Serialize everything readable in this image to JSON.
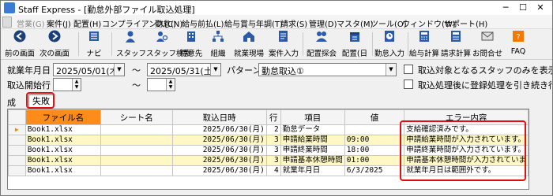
{
  "window": {
    "title": "Staff Express - [勤怠外部ファイル取込処理]"
  },
  "menu": [
    "営業(G)",
    "案件(J)",
    "配置(H)",
    "コンプライアンス(C)",
    "勤怠(N)",
    "給与前払(L)",
    "給与賞与年調(T)",
    "請求(S)",
    "管理(D)",
    "マスタ(M)",
    "ツール(O)",
    "ウィンドウ(W)",
    "サポート(H)"
  ],
  "toolbar": {
    "prev": "前の画面",
    "next": "次の画面",
    "navi": "ナビ",
    "staff": "スタッフ",
    "staff_search": "スタッフ検索",
    "client": "得意先",
    "org": "組織",
    "site": "就業現場",
    "case": "案件入力",
    "haichi_search": "配置探会",
    "haichi_day": "配置(日",
    "kintai_input": "勤怠入力",
    "kyuyo": "給与計算",
    "seikyu": "請求計算",
    "inquiry": "お問合せ",
    "faq": "FAQ"
  },
  "filters": {
    "work_date_label": "就業年月日",
    "date_from": "2025/05/01(木)",
    "tilde": "～",
    "date_to": "2025/05/31(土)",
    "pattern_label": "パターン",
    "pattern_value": "勤怠取込①",
    "start_row_label": "取込開始行",
    "only_target_label": "取込対象となるスタッフのみを表示する",
    "continue_reg_label": "取込処理後に登録処理を引き続き行う"
  },
  "tabs": {
    "success": "成功",
    "failure": "失敗"
  },
  "grid": {
    "headers": [
      "",
      "ファイル名",
      "シート名",
      "取込日時",
      "行",
      "項目",
      "値",
      "エラー内容"
    ],
    "rows": [
      [
        "▶",
        "Book1.xlsx",
        "",
        "2025/06/30(月)",
        "2",
        "勤怠データ",
        "",
        "支給確認済みです。"
      ],
      [
        "",
        "Book1.xlsx",
        "",
        "2025/06/30(月)",
        "3",
        "申請給業時間",
        "09:00",
        "申請給業時間が入力されています。"
      ],
      [
        "",
        "Book1.xlsx",
        "",
        "2025/06/30(月)",
        "3",
        "申請終業時間",
        "18:00",
        "申請終業時間が入力されています。"
      ],
      [
        "",
        "Book1.xlsx",
        "",
        "2025/06/30(月)",
        "3",
        "申請基本休憩時間",
        "01:00",
        "申請基本休憩時間が入力されていま"
      ],
      [
        "",
        "Book1.xlsx",
        "",
        "2025/06/30(月)",
        "4",
        "就業年月日",
        "6/3/2025",
        "就業年月日は範囲外です。"
      ]
    ]
  },
  "colors": {
    "header_highlight": "#ff8c1a",
    "row_alt": "#fff8c4",
    "annotation_red": "#e01010"
  }
}
